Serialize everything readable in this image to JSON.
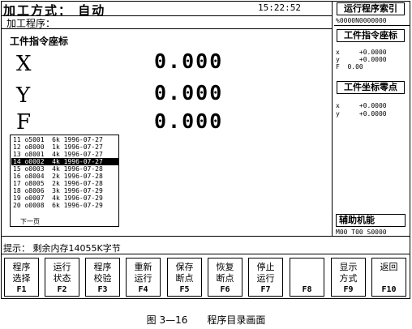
{
  "header": {
    "mode": "加工方式： 自动",
    "time": "15:22:52",
    "program_label": "加工程序："
  },
  "main": {
    "title": "工件指令座标",
    "axes": [
      {
        "label": "X",
        "value": "0.000"
      },
      {
        "label": "Y",
        "value": "0.000"
      },
      {
        "label": "F",
        "value": "0.000"
      }
    ]
  },
  "program_list": {
    "rows": [
      "11 o5001  6k 1996-07-27",
      "12 o8000  1k 1996-07-27",
      "13 o8001  4k 1996-07-27",
      "14 o0002  4k 1996-07-27",
      "15 o0003  4k 1996-07-28",
      "16 o8004  2k 1996-07-28",
      "17 o8005  2k 1996-07-28",
      "18 o8006  3k 1996-07-29",
      "19 o0007  4k 1996-07-29",
      "20 o0008  6k 1996-07-29"
    ],
    "selected_index": 3,
    "next_page": "下一页"
  },
  "right": {
    "index_title": "运行程序索引",
    "index_value": "%0000N0000000",
    "cmd_title": "工件指令座标",
    "cmd_lines": [
      "x     +0.0000",
      "y     +0.0000",
      "F  0.00"
    ],
    "zero_title": "工件坐标零点",
    "zero_lines": [
      "x     +0.0000",
      "y     +0.0000"
    ],
    "aux_title": "辅助机能",
    "aux_value": "M00 T00 S0000"
  },
  "status": "提示： 剩余内存14055K字节",
  "softkeys": [
    {
      "label1": "程序",
      "label2": "选择",
      "fn": "F1"
    },
    {
      "label1": "运行",
      "label2": "状态",
      "fn": "F2"
    },
    {
      "label1": "程序",
      "label2": "校验",
      "fn": "F3"
    },
    {
      "label1": "重新",
      "label2": "运行",
      "fn": "F4"
    },
    {
      "label1": "保存",
      "label2": "断点",
      "fn": "F5"
    },
    {
      "label1": "恢复",
      "label2": "断点",
      "fn": "F6"
    },
    {
      "label1": "停止",
      "label2": "运行",
      "fn": "F7"
    },
    {
      "label1": "",
      "label2": "",
      "fn": "F8"
    },
    {
      "label1": "显示",
      "label2": "方式",
      "fn": "F9"
    },
    {
      "label1": "返回",
      "label2": "",
      "fn": "F10"
    }
  ],
  "caption": "图 3—16　　程序目录画面"
}
